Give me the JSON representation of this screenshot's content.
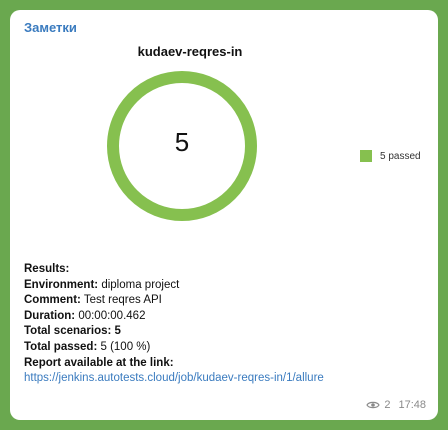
{
  "message": {
    "sender": "Заметки",
    "report": {
      "title": "kudaev-reqres-in",
      "results_label": "Results:",
      "environment_label": "Environment:",
      "environment_value": "diploma project",
      "comment_label": "Comment:",
      "comment_value": "Test reqres API",
      "duration_label": "Duration:",
      "duration_value": "00:00:00.462",
      "total_scenarios_label": "Total scenarios:",
      "total_scenarios_value": "5",
      "total_passed_label": "Total passed:",
      "total_passed_value": "5 (100 %)",
      "report_link_label": "Report available at the link:",
      "report_link": "https://jenkins.autotests.cloud/job/kudaev-reqres-in/1/allure"
    },
    "views": "2",
    "time": "17:48"
  },
  "chart_data": {
    "type": "pie",
    "title": "kudaev-reqres-in",
    "center_label": "5",
    "slices": [
      {
        "label": "5 passed",
        "value": 5,
        "color": "#86c04f"
      }
    ],
    "legend_placement": "right"
  },
  "colors": {
    "background": "#6aa84f",
    "accent": "#3a7bbf",
    "passed": "#86c04f"
  },
  "icons": {
    "views": "eye-icon"
  }
}
